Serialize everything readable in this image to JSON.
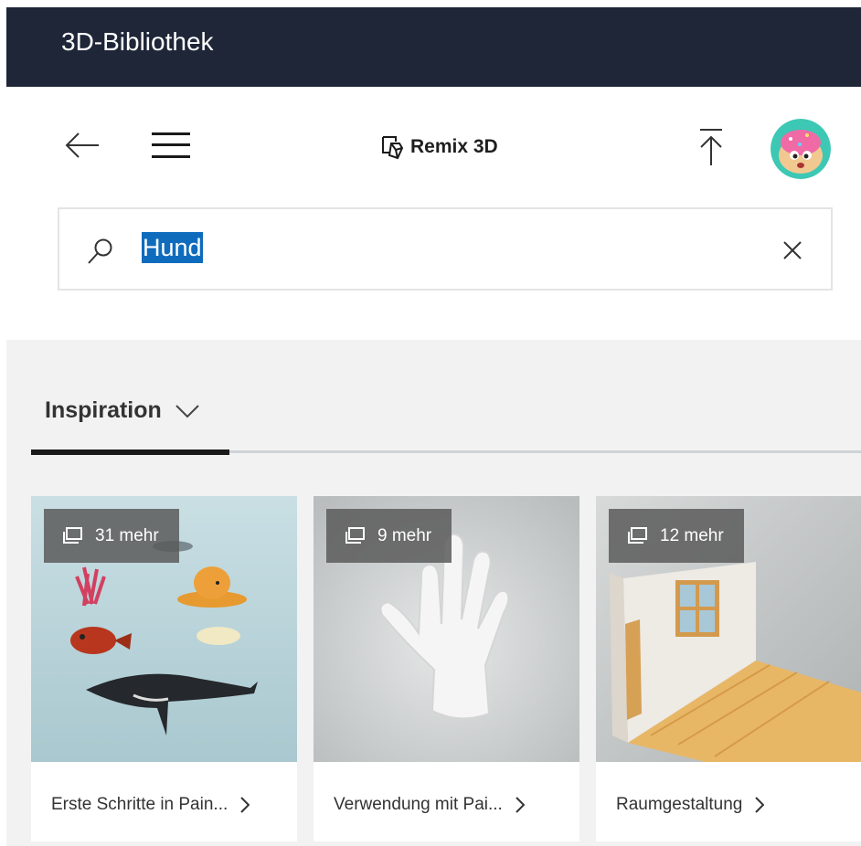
{
  "window": {
    "title": "3D-Bibliothek"
  },
  "nav": {
    "back_icon": "arrow-left-icon",
    "menu_icon": "hamburger-icon",
    "brand_icon": "remix3d-logo-icon",
    "brand_label": "Remix 3D",
    "upload_icon": "upload-icon",
    "avatar_icon": "donut-avatar"
  },
  "search": {
    "icon": "search-icon",
    "value": "Hund",
    "clear_icon": "close-icon"
  },
  "gallery": {
    "tab_label": "Inspiration",
    "tab_icon": "chevron-down-icon",
    "cards": [
      {
        "badge": "31 mehr",
        "caption": "Erste Schritte in Pain...",
        "thumb": "sea-animals"
      },
      {
        "badge": "9 mehr",
        "caption": "Verwendung mit Pai...",
        "thumb": "hand"
      },
      {
        "badge": "12 mehr",
        "caption": "Raumgestaltung",
        "thumb": "room"
      }
    ]
  },
  "colors": {
    "titlebar": "#1e2638",
    "selection": "#0f6cbd",
    "gallery_bg": "#f2f2f2"
  }
}
